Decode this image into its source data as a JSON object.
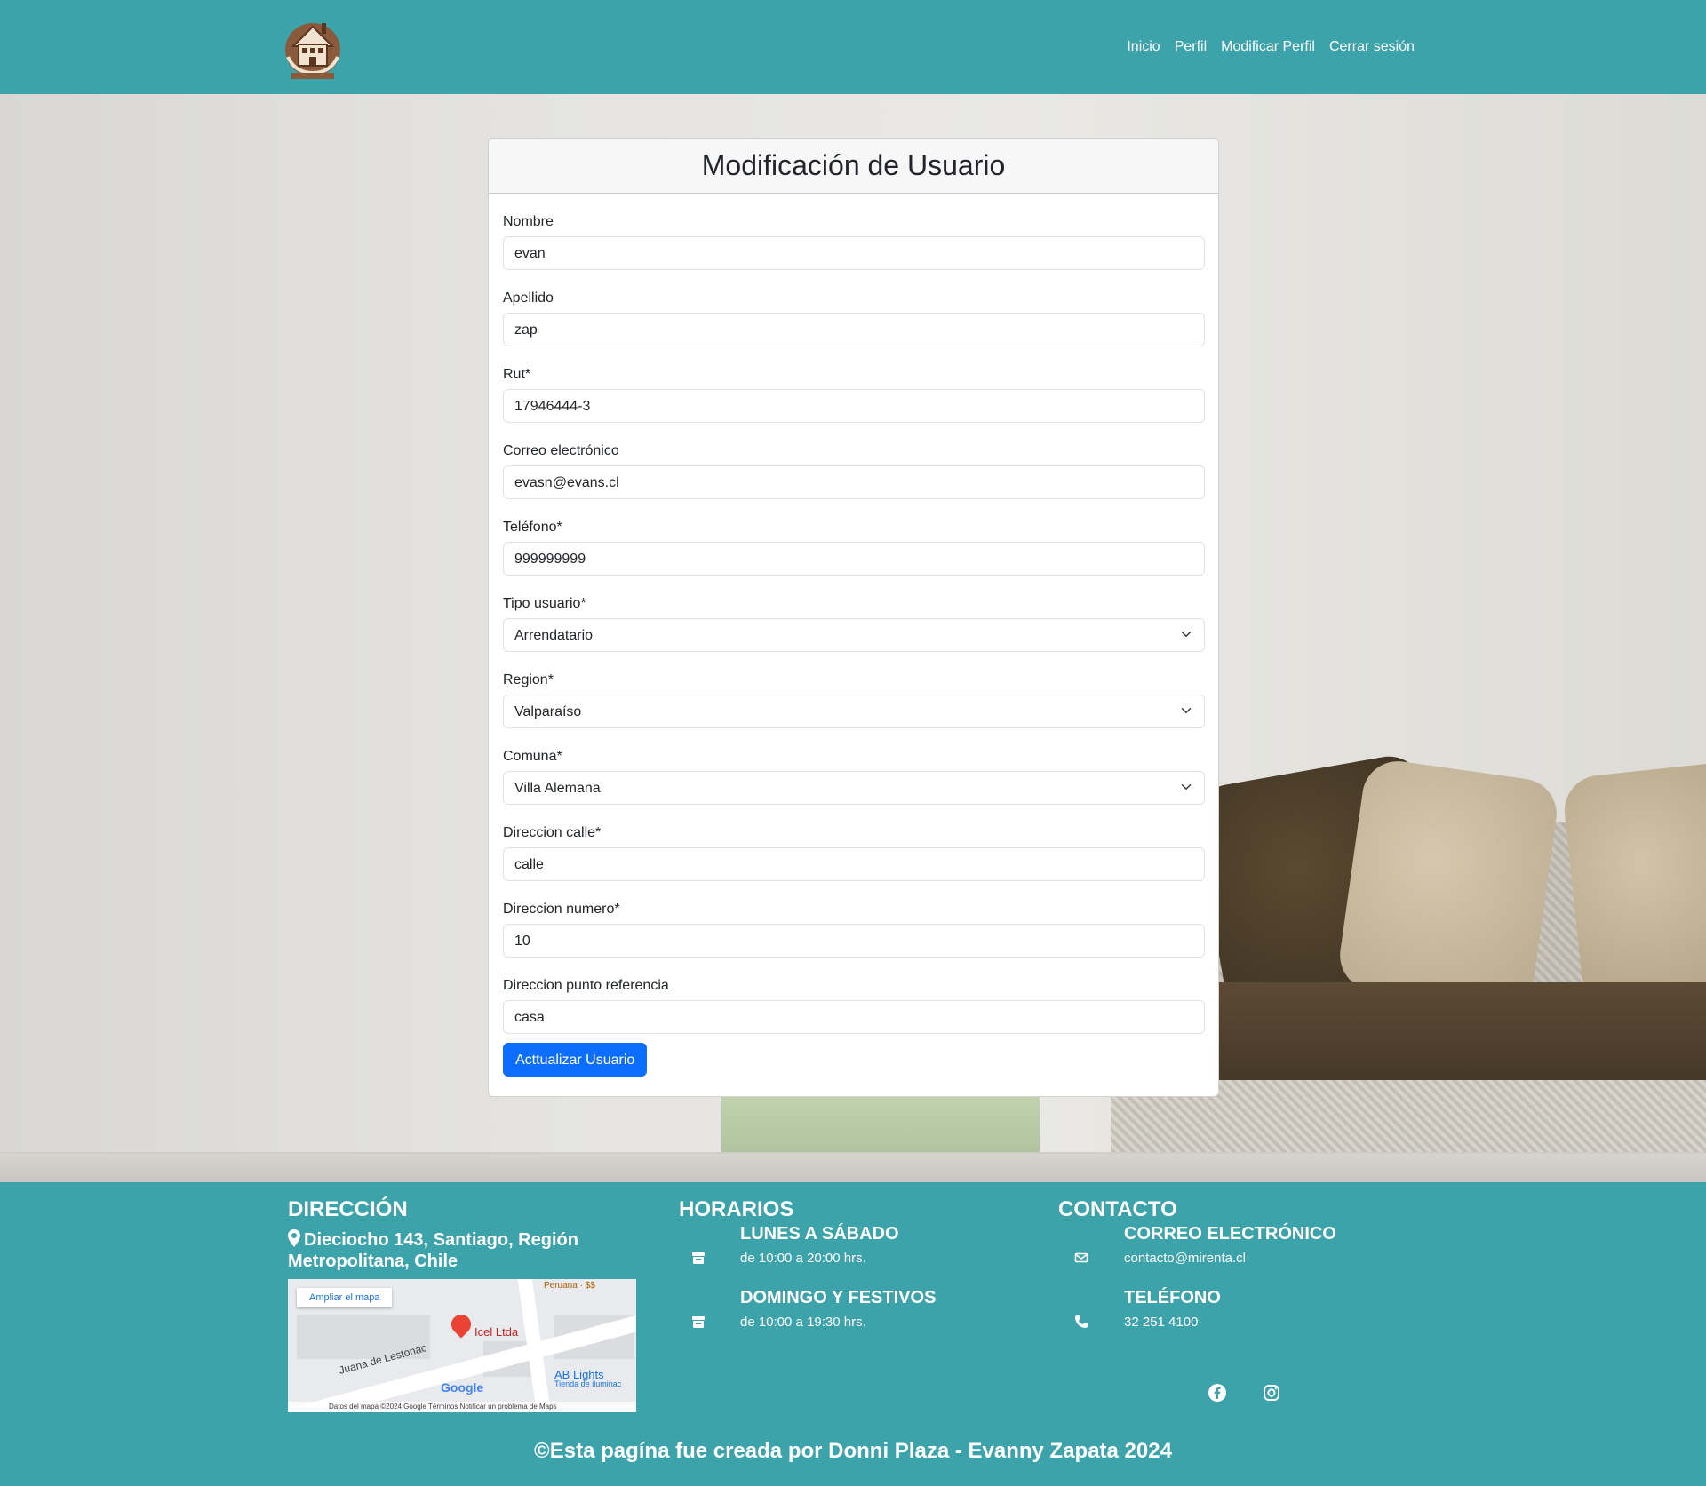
{
  "nav": {
    "logo_alt": "Mi Renta",
    "links": [
      "Inicio",
      "Perfil",
      "Modificar Perfil",
      "Cerrar sesión"
    ]
  },
  "form": {
    "title": "Modificación de Usuario",
    "fields": [
      {
        "label": "Nombre",
        "value": "evan",
        "type": "input"
      },
      {
        "label": "Apellido",
        "value": "zap",
        "type": "input"
      },
      {
        "label": "Rut*",
        "value": "17946444-3",
        "type": "input"
      },
      {
        "label": "Correo electrónico",
        "value": "evasn@evans.cl",
        "type": "input"
      },
      {
        "label": "Teléfono*",
        "value": "999999999",
        "type": "input"
      },
      {
        "label": "Tipo usuario*",
        "value": "Arrendatario",
        "type": "select"
      },
      {
        "label": "Region*",
        "value": "Valparaíso",
        "type": "select"
      },
      {
        "label": "Comuna*",
        "value": "Villa Alemana",
        "type": "select"
      },
      {
        "label": "Direccion calle*",
        "value": "calle",
        "type": "input"
      },
      {
        "label": "Direccion numero*",
        "value": "10",
        "type": "input"
      },
      {
        "label": "Direccion punto referencia",
        "value": "casa",
        "type": "input"
      }
    ],
    "submit_label": "Acttualizar Usuario"
  },
  "footer": {
    "direccion": {
      "title": "DIRECCIÓN",
      "address": "Dieciocho 143, Santiago, Región Metropolitana, Chile",
      "map": {
        "ampliar": "Ampliar el mapa",
        "place": "Icel Ltda",
        "street": "Juana de Lestonac",
        "poi1": "AB Lights",
        "poi1_sub": "Tienda de iluminac",
        "poi2": "Peruana · $$",
        "google": "Google",
        "attribution": "Datos del mapa ©2024 Google   Términos   Notificar un problema de Maps"
      }
    },
    "horarios": {
      "title": "HORARIOS",
      "rows": [
        {
          "title": "LUNES A SÁBADO",
          "sub": "de 10:00 a 20:00 hrs."
        },
        {
          "title": "DOMINGO Y FESTIVOS",
          "sub": "de 10:00 a 19:30 hrs."
        }
      ]
    },
    "contacto": {
      "title": "CONTACTO",
      "rows": [
        {
          "title": "CORREO ELECTRÓNICO",
          "sub": "contacto@mirenta.cl"
        },
        {
          "title": "TELÉFONO",
          "sub": "32 251 4100"
        }
      ]
    },
    "copyright": "©Esta pagína fue creada por Donni Plaza - Evanny Zapata 2024"
  },
  "colors": {
    "brand_teal": "#3ca3ab",
    "primary_button": "#0d6efd"
  },
  "icons": {
    "map_marker": "map-marker-icon",
    "store": "store-icon",
    "envelope": "envelope-icon",
    "phone": "phone-icon",
    "facebook": "facebook-icon",
    "instagram": "instagram-icon",
    "chevron": "chevron-down-icon"
  }
}
